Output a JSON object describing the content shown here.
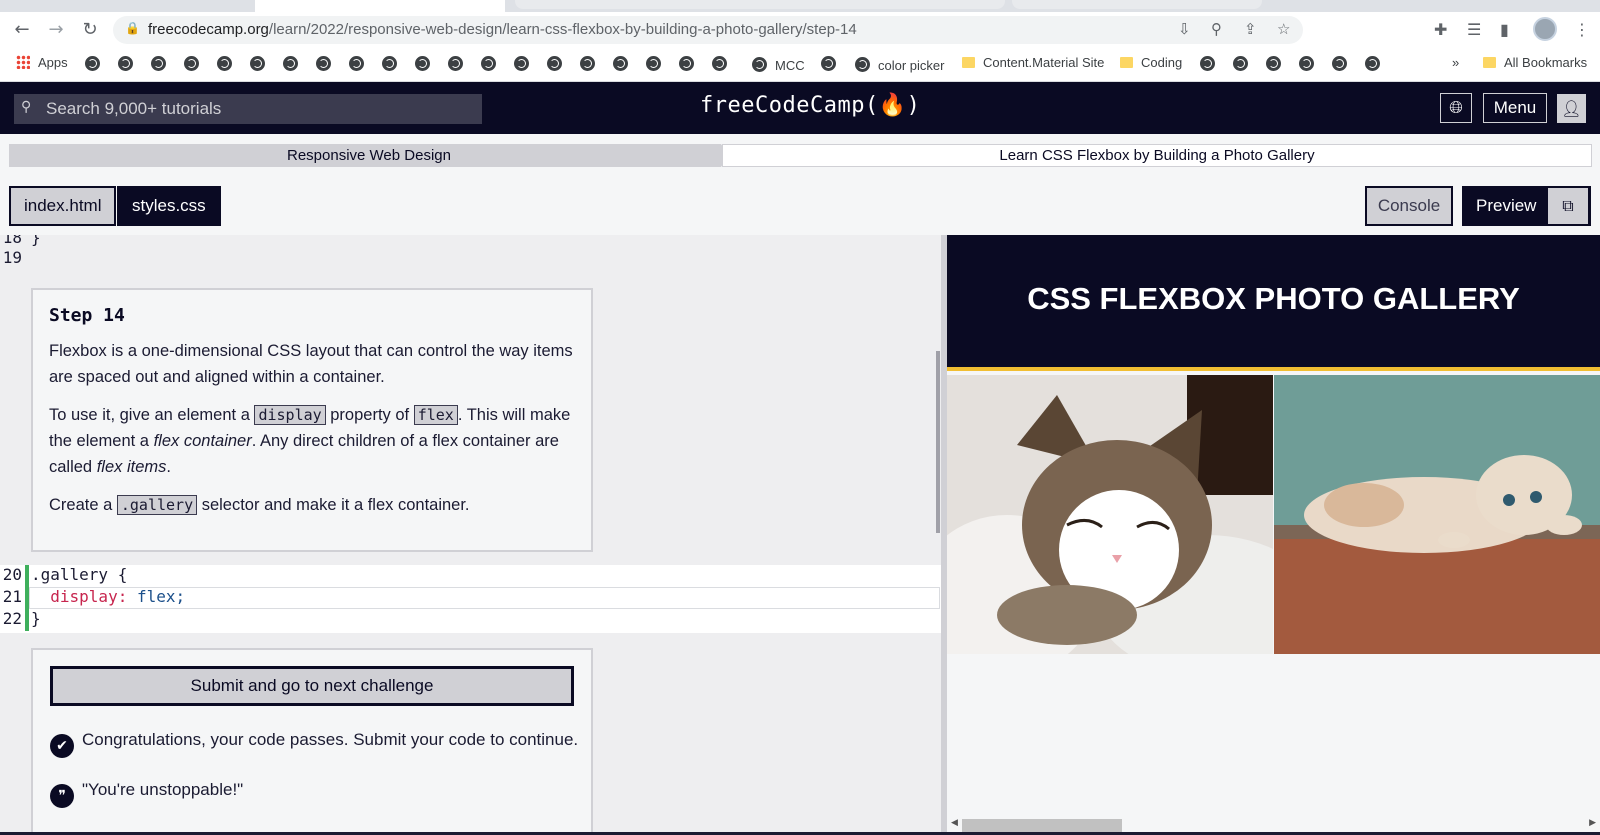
{
  "browser": {
    "url_host": "freecodecamp.org",
    "url_path": "/learn/2022/responsive-web-design/learn-css-flexbox-by-building-a-photo-gallery/step-14",
    "bookmarks": {
      "apps": "Apps",
      "mcc": "MCC",
      "color_picker": "color picker",
      "content_material": "Content.Material Site",
      "coding": "Coding",
      "more": "»",
      "all_bookmarks": "All Bookmarks"
    }
  },
  "navbar": {
    "search_placeholder": "Search 9,000+ tutorials",
    "logo": "freeCodeCamp(🔥)",
    "menu_label": "Menu"
  },
  "breadcrumb": {
    "superblock": "Responsive Web Design",
    "block": "Learn CSS Flexbox by Building a Photo Gallery"
  },
  "editor_tabs": {
    "index": "index.html",
    "styles": "styles.css",
    "console": "Console",
    "preview": "Preview"
  },
  "editor": {
    "line_numbers": [
      "18",
      "19",
      "20",
      "21",
      "22"
    ],
    "line18_code": "}",
    "selector": ".gallery",
    "open_brace": "{",
    "property": "display:",
    "value": "flex;",
    "close_brace": "}"
  },
  "instructions": {
    "title": "Step 14",
    "p1": "Flexbox is a one-dimensional CSS layout that can control the way items are spaced out and aligned within a container.",
    "p2_a": "To use it, give an element a ",
    "p2_code1": "display",
    "p2_b": " property of ",
    "p2_code2": "flex",
    "p2_c": ". This will make the element a ",
    "p2_em1": "flex container",
    "p2_d": ". Any direct children of a flex container are called ",
    "p2_em2": "flex items",
    "p2_e": ".",
    "p3_a": "Create a ",
    "p3_code": ".gallery",
    "p3_b": " selector and make it a flex container."
  },
  "results": {
    "submit_label": "Submit and go to next challenge",
    "pass_message": "Congratulations, your code passes. Submit your code to continue.",
    "quote": "\"You're unstoppable!\""
  },
  "preview_page": {
    "heading": "CSS FLEXBOX PHOTO GALLERY"
  },
  "colors": {
    "fcc_dark": "#0a0a23",
    "accent_yellow": "#f1be32",
    "gutter_green": "#3eaf5c"
  }
}
